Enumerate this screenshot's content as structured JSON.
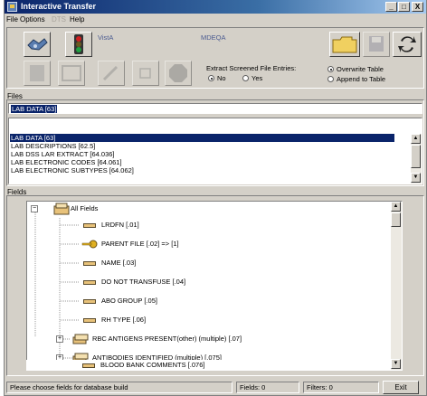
{
  "window": {
    "title": "Interactive Transfer",
    "controls": {
      "minimize": "_",
      "maximize": "□",
      "close": "X"
    }
  },
  "menu": {
    "file": "File",
    "options": "Options",
    "dts": "DTS",
    "help": "Help"
  },
  "toolbar": {
    "source_label": "VistA",
    "target_label": "MDEQA",
    "extract_label": "Extract Screened File Entries:",
    "extract_no": "No",
    "extract_yes": "Yes",
    "extract_selected": "No",
    "overwrite_label": "Overwrite Table",
    "append_label": "Append to Table",
    "table_selected": "Overwrite Table"
  },
  "files": {
    "group_label": "Files",
    "input_value": "LAB DATA [63]",
    "items": [
      "LAB DATA [63]",
      "LAB DESCRIPTIONS [62.5]",
      "LAB DSS LAR EXTRACT [64.036]",
      "LAB ELECTRONIC CODES [64.061]",
      "LAB ELECTRONIC SUBTYPES [64.062]"
    ],
    "selected_index": 0
  },
  "fields": {
    "group_label": "Fields",
    "root": {
      "expander": "−",
      "label": "All Fields"
    },
    "items": [
      {
        "label": "LRDFN [.01]",
        "icon": "field-icon"
      },
      {
        "label": "PARENT FILE [.02] => [1]",
        "icon": "key-icon"
      },
      {
        "label": "NAME [.03]",
        "icon": "field-icon"
      },
      {
        "label": "DO NOT TRANSFUSE [.04]",
        "icon": "field-icon"
      },
      {
        "label": "ABO GROUP [.05]",
        "icon": "field-icon"
      },
      {
        "label": "RH TYPE [.06]",
        "icon": "field-icon"
      },
      {
        "label": "RBC ANTIGENS PRESENT(other) (multiple) [.07]",
        "icon": "multiple-icon",
        "expander": "+"
      },
      {
        "label": "ANTIBODIES IDENTIFIED (multiple) [.075]",
        "icon": "multiple-icon",
        "expander": "+"
      },
      {
        "label": "BLOOD BANK COMMENTS [.076]",
        "icon": "field-icon"
      }
    ]
  },
  "status": {
    "message": "Please choose fields for database build",
    "fields_count": "Fields: 0",
    "filters_count": "Filters: 0",
    "exit": "Exit"
  },
  "scroll": {
    "up": "▲",
    "down": "▼"
  }
}
